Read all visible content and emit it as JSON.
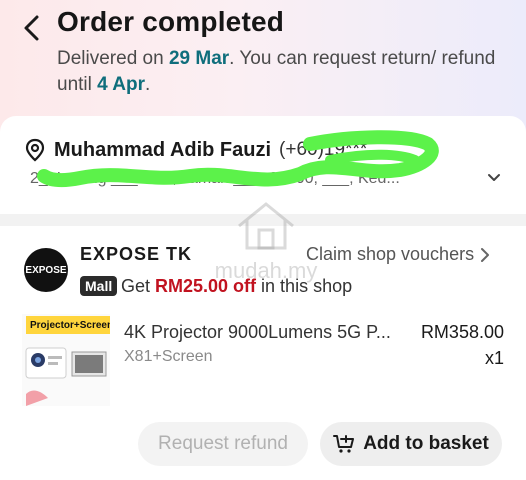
{
  "header": {
    "title": "Order completed",
    "subtitle_pre": "Delivered on ",
    "delivered_date": "29 Mar",
    "subtitle_mid": ". You can request return/ refund until ",
    "refund_until": "4 Apr",
    "subtitle_post": "."
  },
  "address": {
    "name": "Muhammad Adib Fauzi",
    "phone": "(+60)19***",
    "line": "2_, Lorong ___ 1c/1, Taman ___, 09000, ___, Ked..."
  },
  "shop": {
    "logo_text": "EXPOSE",
    "name": "EXPOSE TK",
    "claim_label": "Claim shop vouchers",
    "badge": "Mall",
    "promo_pre": "Get ",
    "promo_amount": "RM25.00 off",
    "promo_post": " in this shop"
  },
  "product": {
    "thumb_label": "Projector+Screen",
    "title": "4K Projector 9000Lumens 5G P...",
    "variant": "X81+Screen",
    "price": "RM358.00",
    "quantity": "x1"
  },
  "actions": {
    "refund_label": "Request refund",
    "basket_label": "Add to basket"
  },
  "watermark": {
    "text": "mudah.my"
  },
  "colors": {
    "accent_date": "#0f6e7c",
    "promo_red": "#c1121f",
    "scribble_green": "#5cf24a"
  }
}
